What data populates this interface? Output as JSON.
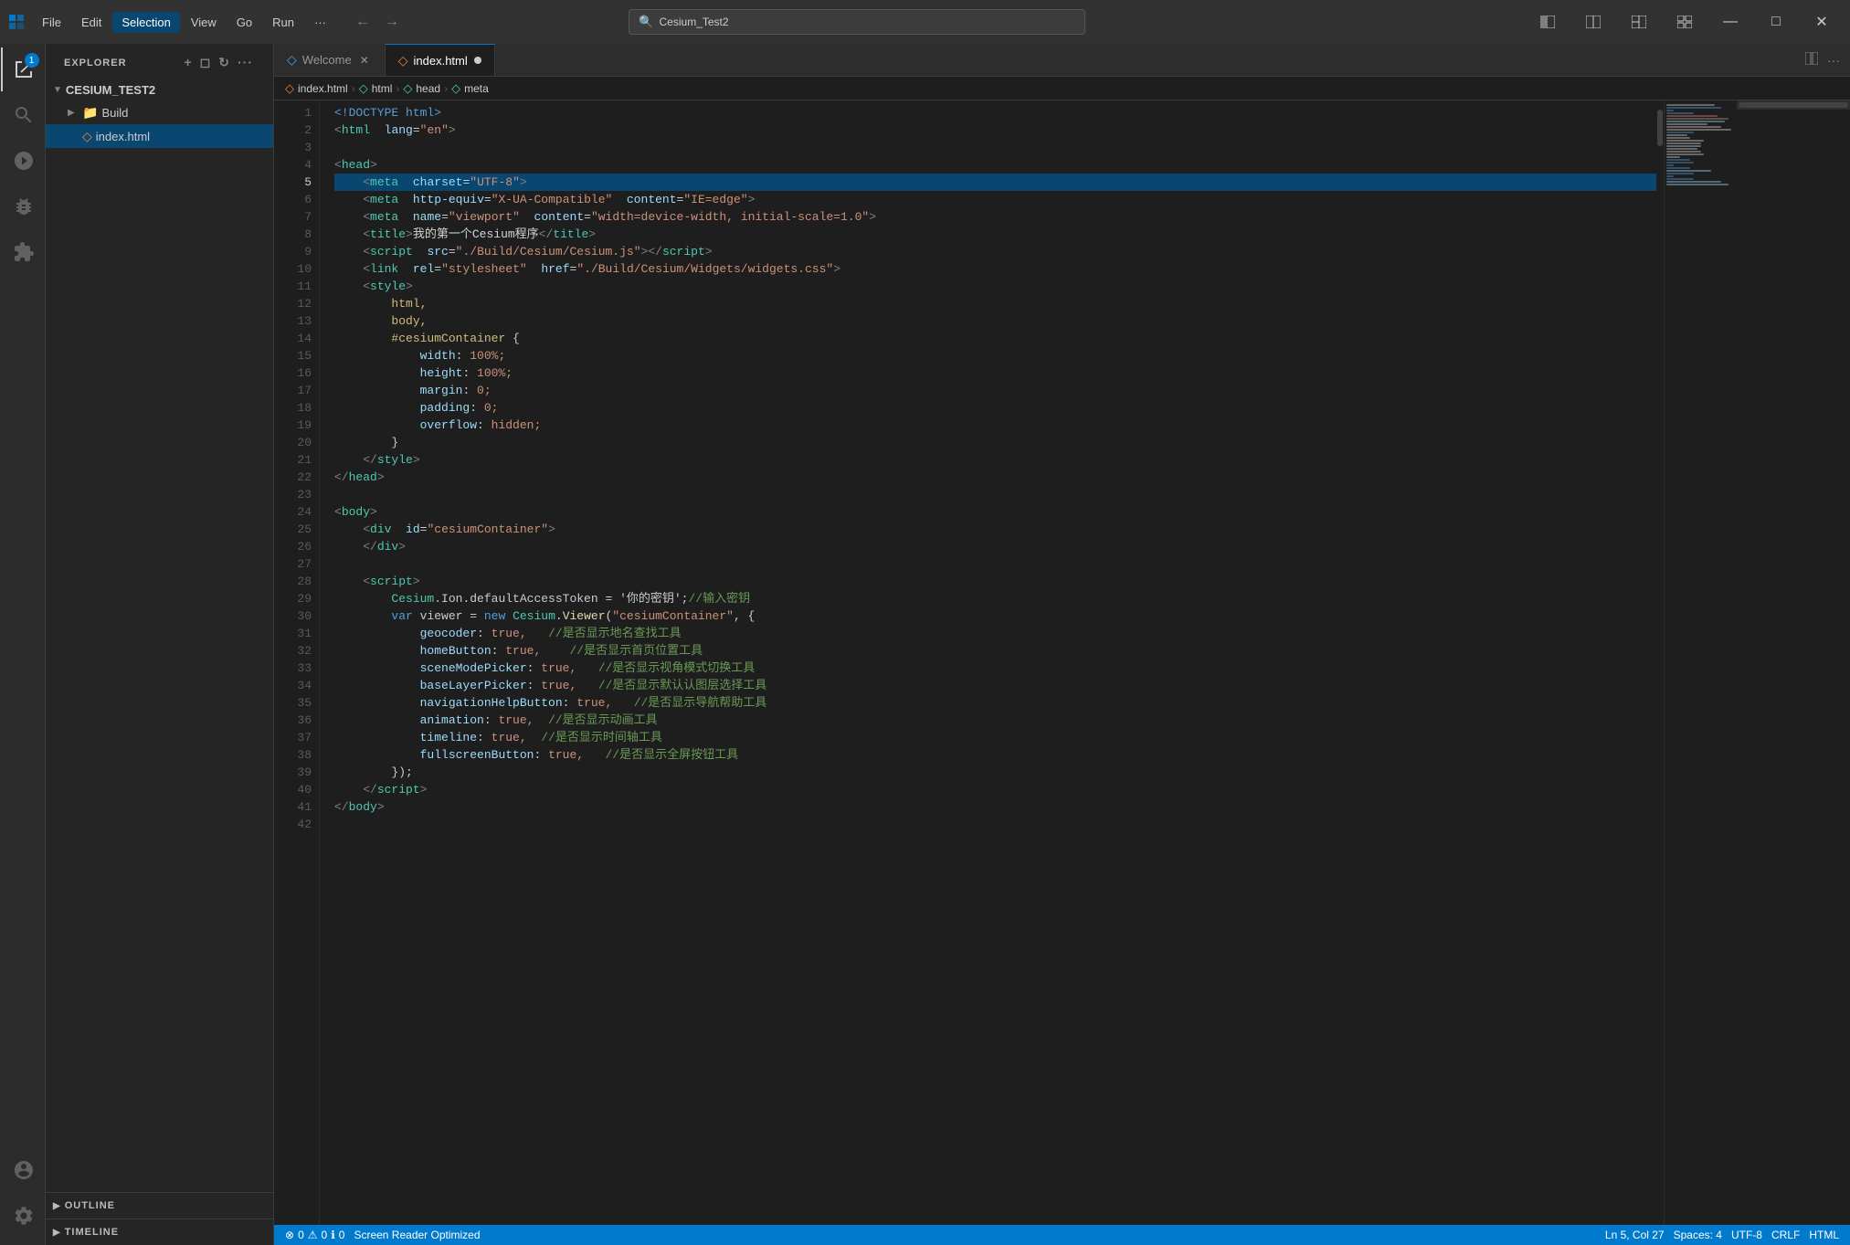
{
  "titlebar": {
    "icon": "◆",
    "menu": [
      "File",
      "Edit",
      "Selection",
      "View",
      "Go",
      "Run",
      "···"
    ],
    "search_text": "Cesium_Test2",
    "window_controls": [
      "⬜⬜",
      "⬜⬜⬜",
      "⬜⬜⬜⬜",
      "—",
      "⬜",
      "✕"
    ]
  },
  "tabs": [
    {
      "label": "Welcome",
      "icon": "◇",
      "active": false,
      "modified": false
    },
    {
      "label": "index.html",
      "icon": "◇",
      "active": true,
      "modified": true
    }
  ],
  "breadcrumb": [
    "index.html",
    "html",
    "head",
    "meta"
  ],
  "explorer": {
    "title": "EXPLORER",
    "project": "CESIUM_TEST2",
    "items": [
      {
        "label": "Build",
        "type": "folder",
        "indent": 1,
        "collapsed": true
      },
      {
        "label": "index.html",
        "type": "html",
        "indent": 1,
        "active": true
      }
    ]
  },
  "sidebar_sections": [
    {
      "label": "OUTLINE",
      "collapsed": true
    },
    {
      "label": "TIMELINE",
      "collapsed": true
    }
  ],
  "lines": [
    {
      "num": 1,
      "content": "<!DOCTYPE html>"
    },
    {
      "num": 2,
      "content": "<html lang=\"en\">"
    },
    {
      "num": 3,
      "content": ""
    },
    {
      "num": 4,
      "content": "<head>"
    },
    {
      "num": 5,
      "content": "    <meta charset=\"UTF-8\">",
      "highlighted": true
    },
    {
      "num": 6,
      "content": "    <meta http-equiv=\"X-UA-Compatible\" content=\"IE=edge\">"
    },
    {
      "num": 7,
      "content": "    <meta name=\"viewport\" content=\"width=device-width, initial-scale=1.0\">"
    },
    {
      "num": 8,
      "content": "    <title>我的第一个Cesium程序</title>"
    },
    {
      "num": 9,
      "content": "    <script src=\"./Build/Cesium/Cesium.js\"></script>"
    },
    {
      "num": 10,
      "content": "    <link rel=\"stylesheet\" href=\"./Build/Cesium/Widgets/widgets.css\">"
    },
    {
      "num": 11,
      "content": "    <style>"
    },
    {
      "num": 12,
      "content": "        html,"
    },
    {
      "num": 13,
      "content": "        body,"
    },
    {
      "num": 14,
      "content": "        #cesiumContainer {"
    },
    {
      "num": 15,
      "content": "            width: 100%;"
    },
    {
      "num": 16,
      "content": "            height: 100%;"
    },
    {
      "num": 17,
      "content": "            margin: 0;"
    },
    {
      "num": 18,
      "content": "            padding: 0;"
    },
    {
      "num": 19,
      "content": "            overflow: hidden;"
    },
    {
      "num": 20,
      "content": "        }"
    },
    {
      "num": 21,
      "content": "    </style>"
    },
    {
      "num": 22,
      "content": "</head>"
    },
    {
      "num": 23,
      "content": ""
    },
    {
      "num": 24,
      "content": "<body>"
    },
    {
      "num": 25,
      "content": "    <div id=\"cesiumContainer\">"
    },
    {
      "num": 26,
      "content": "    </div>"
    },
    {
      "num": 27,
      "content": ""
    },
    {
      "num": 28,
      "content": "    <script>"
    },
    {
      "num": 29,
      "content": "        Cesium.Ion.defaultAccessToken = '你的密钥';//输入密钥"
    },
    {
      "num": 30,
      "content": "        var viewer = new Cesium.Viewer(\"cesiumContainer\", {"
    },
    {
      "num": 31,
      "content": "            geocoder: true,   //是否显示地名查找工具"
    },
    {
      "num": 32,
      "content": "            homeButton: true,    //是否显示首页位置工具"
    },
    {
      "num": 33,
      "content": "            sceneModePicker: true,   //是否显示视角模式切换工具"
    },
    {
      "num": 34,
      "content": "            baseLayerPicker: true,   //是否显示默认认图层选择工具"
    },
    {
      "num": 35,
      "content": "            navigationHelpButton: true,   //是否显示导航帮助工具"
    },
    {
      "num": 36,
      "content": "            animation: true,  //是否显示动画工具"
    },
    {
      "num": 37,
      "content": "            timeline: true,  //是否显示时间轴工具"
    },
    {
      "num": 38,
      "content": "            fullscreenButton: true,   //是否显示全屏按钮工具"
    },
    {
      "num": 39,
      "content": "        });"
    },
    {
      "num": 40,
      "content": "    </script>"
    },
    {
      "num": 41,
      "content": "</body>"
    },
    {
      "num": 42,
      "content": ""
    }
  ],
  "statusbar": {
    "errors": "0",
    "warnings": "0",
    "infos": "0",
    "position": "Ln 5, Col 27",
    "spaces": "Spaces: 4",
    "encoding": "UTF-8",
    "line_ending": "CRLF",
    "language": "HTML",
    "reader": "Screen Reader Optimized"
  }
}
